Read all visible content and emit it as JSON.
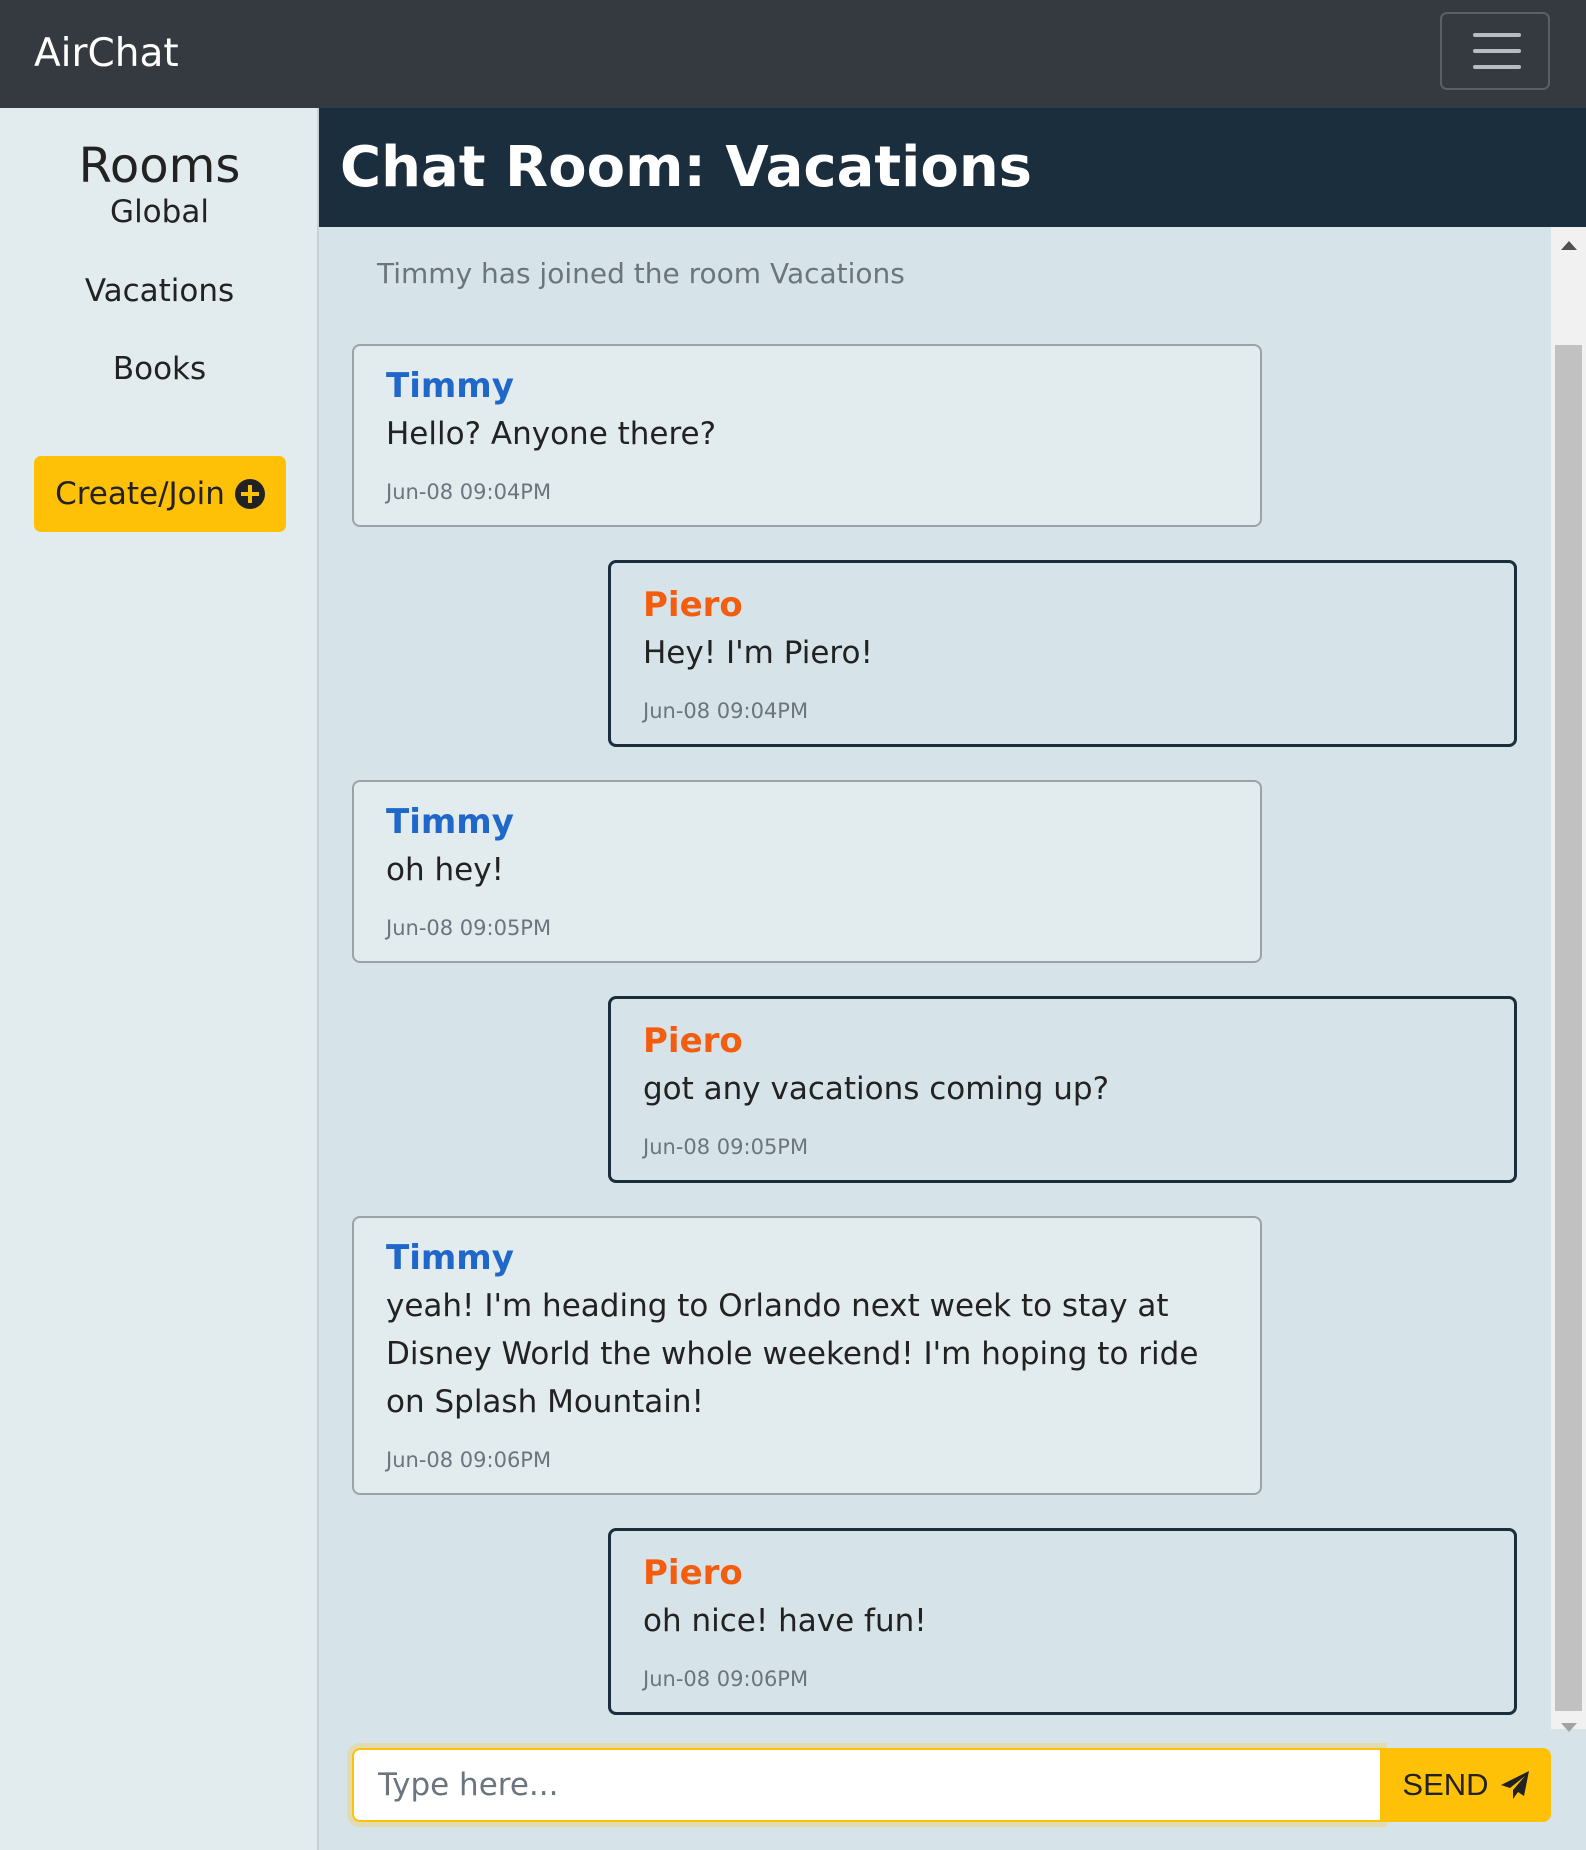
{
  "app": {
    "brand": "AirChat"
  },
  "sidebar": {
    "title": "Rooms",
    "rooms": [
      "Global",
      "Vacations",
      "Books"
    ],
    "create_label": "Create/Join"
  },
  "room": {
    "title": "Chat Room: Vacations"
  },
  "chat": {
    "system_message": "Timmy has joined the room Vacations",
    "messages": [
      {
        "author": "Timmy",
        "text": "Hello? Anyone there?",
        "time": "Jun-08 09:04PM"
      },
      {
        "author": "Piero",
        "text": "Hey! I'm Piero!",
        "time": "Jun-08 09:04PM"
      },
      {
        "author": "Timmy",
        "text": "oh hey!",
        "time": "Jun-08 09:05PM"
      },
      {
        "author": "Piero",
        "text": "got any vacations coming up?",
        "time": "Jun-08 09:05PM"
      },
      {
        "author": "Timmy",
        "text": "yeah! I'm heading to Orlando next week to stay at Disney World the whole weekend! I'm hoping to ride on Splash Mountain!",
        "time": "Jun-08 09:06PM"
      },
      {
        "author": "Piero",
        "text": "oh nice! have fun!",
        "time": "Jun-08 09:06PM"
      }
    ]
  },
  "composer": {
    "placeholder": "Type here...",
    "value": "",
    "send_label": "SEND"
  },
  "colors": {
    "navbar": "#343a40",
    "header": "#1a2e3e",
    "accent": "#ffc107",
    "timmy": "#1f67c8",
    "piero": "#f25d0f"
  }
}
